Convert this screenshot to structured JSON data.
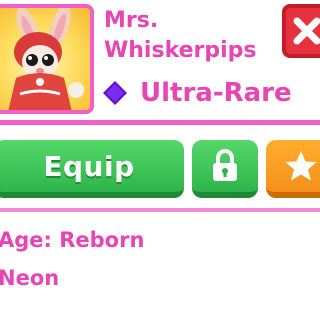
{
  "pet": {
    "name": "Mrs.\nWhiskerpips",
    "rarity": "Ultra-Rare",
    "image_icon": "bunny-pet-portrait"
  },
  "actions": {
    "equip_label": "Equip",
    "lock_icon": "lock-icon",
    "favorite_icon": "star-icon",
    "close_icon": "close-x-icon"
  },
  "details": {
    "age": "Age: Reborn",
    "neon": "Neon"
  },
  "colors": {
    "accent": "#e845b4",
    "equip_green": "#3cc456",
    "favorite_orange": "#f7a022",
    "close_red": "#e5323c",
    "rarity_purple": "#6a1bd8"
  }
}
